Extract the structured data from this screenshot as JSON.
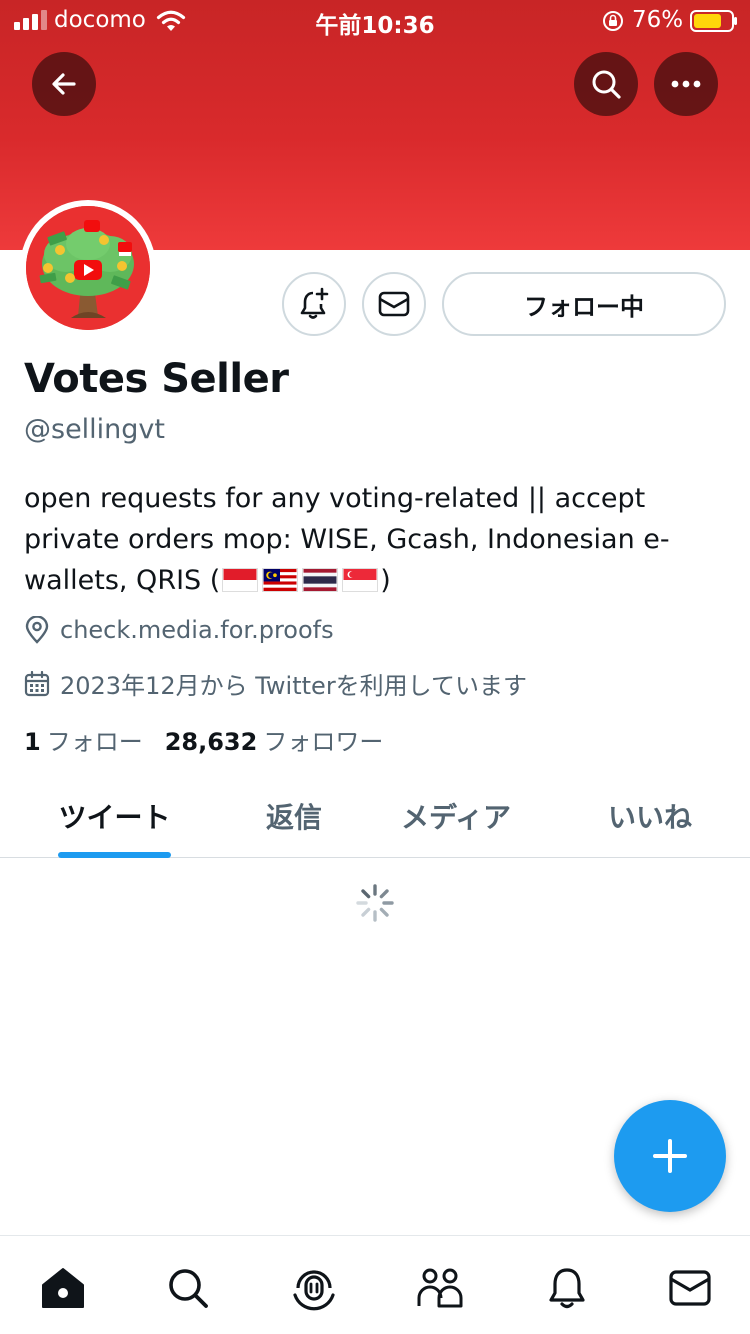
{
  "status_bar": {
    "carrier": "docomo",
    "time": "午前10:36",
    "battery_percent": "76%",
    "battery_level": 0.76
  },
  "header": {
    "back_icon": "arrow-left-icon",
    "search_icon": "search-icon",
    "more_icon": "more-horizontal-icon",
    "banner_color": "#d92a2c"
  },
  "profile": {
    "display_name": "Votes Seller",
    "handle": "@sellingvt",
    "bio_text": "open requests for any voting-related || accept private orders mop: WISE, Gcash, Indonesian e-wallets, QRIS (",
    "bio_close": ")",
    "flags": [
      "Indonesia",
      "Malaysia",
      "Thailand",
      "Singapore"
    ],
    "location": "check.media.for.proofs",
    "joined": "2023年12月から Twitterを利用しています",
    "following_count": "1",
    "following_label": "フォロー",
    "followers_count": "28,632",
    "followers_label": "フォロワー"
  },
  "actions": {
    "notify_icon": "bell-plus-icon",
    "dm_icon": "envelope-icon",
    "follow_label": "フォロー中"
  },
  "tabs": [
    {
      "label": "ツイート",
      "active": true
    },
    {
      "label": "返信",
      "active": false
    },
    {
      "label": "メディア",
      "active": false
    },
    {
      "label": "いいね",
      "active": false
    }
  ],
  "fab": {
    "icon": "plus-icon",
    "color": "#1d9bf0"
  },
  "bottom_nav": [
    {
      "icon": "home-icon"
    },
    {
      "icon": "search-icon"
    },
    {
      "icon": "spaces-icon"
    },
    {
      "icon": "communities-icon"
    },
    {
      "icon": "bell-icon"
    },
    {
      "icon": "envelope-icon"
    }
  ],
  "colors": {
    "accent": "#1d9bf0",
    "text": "#0f1419",
    "secondary": "#536471"
  }
}
